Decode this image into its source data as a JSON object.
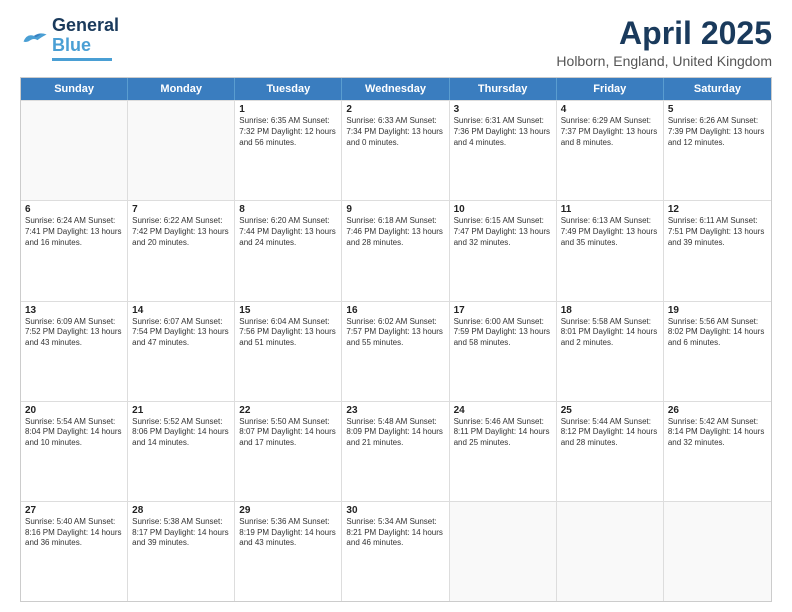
{
  "header": {
    "logo_line1": "General",
    "logo_line2": "Blue",
    "month_title": "April 2025",
    "location": "Holborn, England, United Kingdom"
  },
  "days_of_week": [
    "Sunday",
    "Monday",
    "Tuesday",
    "Wednesday",
    "Thursday",
    "Friday",
    "Saturday"
  ],
  "weeks": [
    [
      {
        "day": "",
        "info": ""
      },
      {
        "day": "",
        "info": ""
      },
      {
        "day": "1",
        "info": "Sunrise: 6:35 AM\nSunset: 7:32 PM\nDaylight: 12 hours and 56 minutes."
      },
      {
        "day": "2",
        "info": "Sunrise: 6:33 AM\nSunset: 7:34 PM\nDaylight: 13 hours and 0 minutes."
      },
      {
        "day": "3",
        "info": "Sunrise: 6:31 AM\nSunset: 7:36 PM\nDaylight: 13 hours and 4 minutes."
      },
      {
        "day": "4",
        "info": "Sunrise: 6:29 AM\nSunset: 7:37 PM\nDaylight: 13 hours and 8 minutes."
      },
      {
        "day": "5",
        "info": "Sunrise: 6:26 AM\nSunset: 7:39 PM\nDaylight: 13 hours and 12 minutes."
      }
    ],
    [
      {
        "day": "6",
        "info": "Sunrise: 6:24 AM\nSunset: 7:41 PM\nDaylight: 13 hours and 16 minutes."
      },
      {
        "day": "7",
        "info": "Sunrise: 6:22 AM\nSunset: 7:42 PM\nDaylight: 13 hours and 20 minutes."
      },
      {
        "day": "8",
        "info": "Sunrise: 6:20 AM\nSunset: 7:44 PM\nDaylight: 13 hours and 24 minutes."
      },
      {
        "day": "9",
        "info": "Sunrise: 6:18 AM\nSunset: 7:46 PM\nDaylight: 13 hours and 28 minutes."
      },
      {
        "day": "10",
        "info": "Sunrise: 6:15 AM\nSunset: 7:47 PM\nDaylight: 13 hours and 32 minutes."
      },
      {
        "day": "11",
        "info": "Sunrise: 6:13 AM\nSunset: 7:49 PM\nDaylight: 13 hours and 35 minutes."
      },
      {
        "day": "12",
        "info": "Sunrise: 6:11 AM\nSunset: 7:51 PM\nDaylight: 13 hours and 39 minutes."
      }
    ],
    [
      {
        "day": "13",
        "info": "Sunrise: 6:09 AM\nSunset: 7:52 PM\nDaylight: 13 hours and 43 minutes."
      },
      {
        "day": "14",
        "info": "Sunrise: 6:07 AM\nSunset: 7:54 PM\nDaylight: 13 hours and 47 minutes."
      },
      {
        "day": "15",
        "info": "Sunrise: 6:04 AM\nSunset: 7:56 PM\nDaylight: 13 hours and 51 minutes."
      },
      {
        "day": "16",
        "info": "Sunrise: 6:02 AM\nSunset: 7:57 PM\nDaylight: 13 hours and 55 minutes."
      },
      {
        "day": "17",
        "info": "Sunrise: 6:00 AM\nSunset: 7:59 PM\nDaylight: 13 hours and 58 minutes."
      },
      {
        "day": "18",
        "info": "Sunrise: 5:58 AM\nSunset: 8:01 PM\nDaylight: 14 hours and 2 minutes."
      },
      {
        "day": "19",
        "info": "Sunrise: 5:56 AM\nSunset: 8:02 PM\nDaylight: 14 hours and 6 minutes."
      }
    ],
    [
      {
        "day": "20",
        "info": "Sunrise: 5:54 AM\nSunset: 8:04 PM\nDaylight: 14 hours and 10 minutes."
      },
      {
        "day": "21",
        "info": "Sunrise: 5:52 AM\nSunset: 8:06 PM\nDaylight: 14 hours and 14 minutes."
      },
      {
        "day": "22",
        "info": "Sunrise: 5:50 AM\nSunset: 8:07 PM\nDaylight: 14 hours and 17 minutes."
      },
      {
        "day": "23",
        "info": "Sunrise: 5:48 AM\nSunset: 8:09 PM\nDaylight: 14 hours and 21 minutes."
      },
      {
        "day": "24",
        "info": "Sunrise: 5:46 AM\nSunset: 8:11 PM\nDaylight: 14 hours and 25 minutes."
      },
      {
        "day": "25",
        "info": "Sunrise: 5:44 AM\nSunset: 8:12 PM\nDaylight: 14 hours and 28 minutes."
      },
      {
        "day": "26",
        "info": "Sunrise: 5:42 AM\nSunset: 8:14 PM\nDaylight: 14 hours and 32 minutes."
      }
    ],
    [
      {
        "day": "27",
        "info": "Sunrise: 5:40 AM\nSunset: 8:16 PM\nDaylight: 14 hours and 36 minutes."
      },
      {
        "day": "28",
        "info": "Sunrise: 5:38 AM\nSunset: 8:17 PM\nDaylight: 14 hours and 39 minutes."
      },
      {
        "day": "29",
        "info": "Sunrise: 5:36 AM\nSunset: 8:19 PM\nDaylight: 14 hours and 43 minutes."
      },
      {
        "day": "30",
        "info": "Sunrise: 5:34 AM\nSunset: 8:21 PM\nDaylight: 14 hours and 46 minutes."
      },
      {
        "day": "",
        "info": ""
      },
      {
        "day": "",
        "info": ""
      },
      {
        "day": "",
        "info": ""
      }
    ]
  ]
}
